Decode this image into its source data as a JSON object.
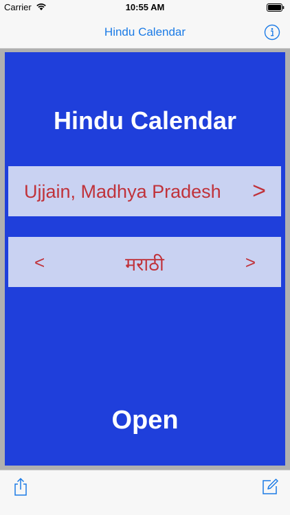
{
  "status_bar": {
    "carrier": "Carrier",
    "time": "10:55 AM"
  },
  "nav_bar": {
    "title": "Hindu Calendar",
    "info_icon": "info-icon"
  },
  "panel": {
    "heading": "Hindu Calendar",
    "location": {
      "label": "Ujjain, Madhya Pradesh",
      "next_symbol": ">"
    },
    "language": {
      "prev_symbol": "<",
      "value": "मराठी",
      "next_symbol": ">"
    },
    "open_label": "Open"
  },
  "toolbar": {
    "left_icon": "share-icon",
    "right_icon": "compose-icon"
  },
  "colors": {
    "accent": "#1a7ae6",
    "panel_blue": "#1f3fdb",
    "row_bg": "#c9d2f2",
    "red_text": "#c0323a",
    "frame_gray": "#b0b0b0"
  }
}
